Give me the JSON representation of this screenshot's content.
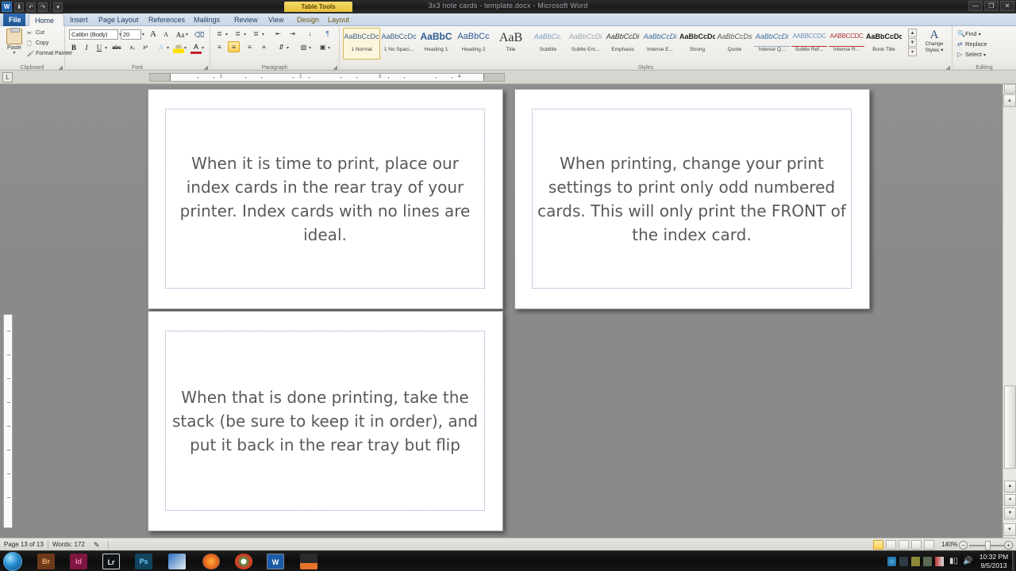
{
  "window": {
    "title": "3x3 note cards - template.docx - Microsoft Word",
    "contextual_tab_label": "Table Tools",
    "logo_text": "W",
    "quick_access": [
      {
        "name": "save",
        "glyph": "⬇"
      },
      {
        "name": "undo",
        "glyph": "↶"
      },
      {
        "name": "redo",
        "glyph": "↷"
      },
      {
        "name": "customize",
        "glyph": "▾"
      }
    ],
    "controls": [
      {
        "name": "minimize",
        "glyph": "—"
      },
      {
        "name": "restore",
        "glyph": "❐"
      },
      {
        "name": "close",
        "glyph": "✕"
      }
    ]
  },
  "tabs": [
    {
      "label": "File",
      "kind": "file"
    },
    {
      "label": "Home",
      "kind": "active"
    },
    {
      "label": "Insert",
      "kind": "normal"
    },
    {
      "label": "Page Layout",
      "kind": "normal"
    },
    {
      "label": "References",
      "kind": "normal"
    },
    {
      "label": "Mailings",
      "kind": "normal"
    },
    {
      "label": "Review",
      "kind": "normal"
    },
    {
      "label": "View",
      "kind": "normal"
    },
    {
      "label": "Design",
      "kind": "tabletools"
    },
    {
      "label": "Layout",
      "kind": "tabletools"
    }
  ],
  "ribbon": {
    "clipboard": {
      "group_label": "Clipboard",
      "paste_label": "Paste",
      "items": [
        {
          "label": "Cut",
          "icon": "scissors-icon"
        },
        {
          "label": "Copy",
          "icon": "copy-icon"
        },
        {
          "label": "Format Painter",
          "icon": "format-painter-icon"
        }
      ]
    },
    "font": {
      "group_label": "Font",
      "font_name": "Calibri (Body)",
      "font_size": "20",
      "buttons": [
        {
          "label": "A",
          "name": "grow-font-icon"
        },
        {
          "label": "A",
          "name": "shrink-font-icon"
        },
        {
          "label": "Aa",
          "name": "change-case-icon"
        },
        {
          "label": "⌫",
          "name": "clear-formatting-icon"
        },
        {
          "label": "B",
          "name": "bold-button"
        },
        {
          "label": "I",
          "name": "italic-button"
        },
        {
          "label": "U",
          "name": "underline-button"
        },
        {
          "label": "abc",
          "name": "strikethrough-button"
        },
        {
          "label": "x₂",
          "name": "subscript-button"
        },
        {
          "label": "x²",
          "name": "superscript-button"
        },
        {
          "label": "A",
          "name": "text-effects-button"
        },
        {
          "label": "ab",
          "name": "text-highlight-button"
        },
        {
          "label": "A",
          "name": "font-color-button"
        }
      ]
    },
    "paragraph": {
      "group_label": "Paragraph",
      "active_alignment": "center",
      "buttons": [
        {
          "name": "bullets-button"
        },
        {
          "name": "numbering-button"
        },
        {
          "name": "multilevel-list-button"
        },
        {
          "name": "decrease-indent-button"
        },
        {
          "name": "increase-indent-button"
        },
        {
          "name": "sort-button"
        },
        {
          "name": "show-marks-button"
        },
        {
          "name": "align-left-button"
        },
        {
          "name": "align-center-button"
        },
        {
          "name": "align-right-button"
        },
        {
          "name": "justify-button"
        },
        {
          "name": "line-spacing-button"
        },
        {
          "name": "shading-button"
        },
        {
          "name": "borders-button"
        }
      ]
    },
    "styles": {
      "group_label": "Styles",
      "selected": "1 Normal",
      "change_styles_label": "Change\nStyles",
      "change_styles_line1": "Change",
      "change_styles_line2": "Styles",
      "gallery": [
        {
          "preview": "AaBbCcDc",
          "name": "1 Normal",
          "style": "normal"
        },
        {
          "preview": "AaBbCcDc",
          "name": "1 No Spaci...",
          "style": "normal"
        },
        {
          "preview": "AaBbC",
          "name": "Heading 1",
          "style": "h1"
        },
        {
          "preview": "AaBbCc",
          "name": "Heading 2",
          "style": "h2"
        },
        {
          "preview": "AaB",
          "name": "Title",
          "style": "title"
        },
        {
          "preview": "AaBbCc.",
          "name": "Subtitle",
          "style": "subtitle"
        },
        {
          "preview": "AaBbCcDi",
          "name": "Subtle Em...",
          "style": "subtleem"
        },
        {
          "preview": "AaBbCcDi",
          "name": "Emphasis",
          "style": "emphasis"
        },
        {
          "preview": "AaBbCcDi",
          "name": "Intense E...",
          "style": "intenseem"
        },
        {
          "preview": "AaBbCcDc",
          "name": "Strong",
          "style": "strong"
        },
        {
          "preview": "AaBbCcDs",
          "name": "Quote",
          "style": "quote"
        },
        {
          "preview": "AaBbCcDi",
          "name": "Intense Q...",
          "style": "intenseq"
        },
        {
          "preview": "AABBCCDC",
          "name": "Subtle Ref...",
          "style": "subtleref"
        },
        {
          "preview": "AABBCCDC",
          "name": "Intense R...",
          "style": "intenseref"
        },
        {
          "preview": "AaBbCcDc",
          "name": "Book Title",
          "style": "booktitle"
        }
      ]
    },
    "editing": {
      "group_label": "Editing",
      "items": [
        {
          "label": "Find",
          "icon": "find-icon"
        },
        {
          "label": "Replace",
          "icon": "replace-icon"
        },
        {
          "label": "Select",
          "icon": "select-icon"
        }
      ]
    }
  },
  "ruler": {
    "tab_stop_marker": "L",
    "numbers": [
      "1",
      "2",
      "3",
      "4"
    ]
  },
  "document": {
    "cards": [
      {
        "id": "card-1",
        "text": "When it is time to print, place our index cards in the rear tray of your printer.  Index cards with no lines are ideal."
      },
      {
        "id": "card-2",
        "text": "When printing, change your print settings to print only odd numbered cards.  This will only print the FRONT of the index card."
      },
      {
        "id": "card-3",
        "text": "When that is done printing, take the stack (be sure to keep it in order), and put it back in the rear tray but flip"
      }
    ]
  },
  "status_bar": {
    "page": "Page 13 of 13",
    "words": "Words: 172",
    "proofing_icon": "spell-check-icon",
    "zoom": "140%",
    "view_buttons": [
      {
        "name": "print-layout-view",
        "active": true
      },
      {
        "name": "full-screen-reading-view",
        "active": false
      },
      {
        "name": "web-layout-view",
        "active": false
      },
      {
        "name": "outline-view",
        "active": false
      },
      {
        "name": "draft-view",
        "active": false
      }
    ],
    "zoom_out": "−",
    "zoom_in": "+"
  },
  "taskbar": {
    "start_name": "start-orb",
    "apps": [
      {
        "label": "Br",
        "name": "taskbar-bridge",
        "bg": "#6d3a1c",
        "fg": "#f0a869"
      },
      {
        "label": "Id",
        "name": "taskbar-indesign",
        "bg": "#7d1640",
        "fg": "#f17fb1"
      },
      {
        "label": "Lr",
        "name": "taskbar-lightroom",
        "bg": "#101418",
        "fg": "#e8eef4"
      },
      {
        "label": "Ps",
        "name": "taskbar-photoshop",
        "bg": "#12445e",
        "fg": "#6cc8f0"
      },
      {
        "label": "",
        "name": "taskbar-outlook",
        "bg": "#1b4b8f",
        "fg": "#ffffff"
      },
      {
        "label": "",
        "name": "taskbar-firefox",
        "bg": "#000000",
        "fg": "#ffffff"
      },
      {
        "label": "",
        "name": "taskbar-chrome",
        "bg": "#000000",
        "fg": "#ffffff"
      },
      {
        "label": "W",
        "name": "taskbar-word",
        "bg": "#1c5ba8",
        "fg": "#ffffff"
      },
      {
        "label": "",
        "name": "taskbar-vlc",
        "bg": "#000000",
        "fg": "#ff8800"
      }
    ],
    "tray": [
      {
        "name": "tray-action-center-icon"
      },
      {
        "name": "tray-dropbox-icon"
      },
      {
        "name": "tray-shield-icon"
      },
      {
        "name": "tray-battery-icon"
      },
      {
        "name": "tray-flag-icon"
      },
      {
        "name": "tray-network-icon"
      },
      {
        "name": "tray-volume-icon"
      }
    ],
    "clock_time": "10:32 PM",
    "clock_date": "9/5/2013"
  }
}
